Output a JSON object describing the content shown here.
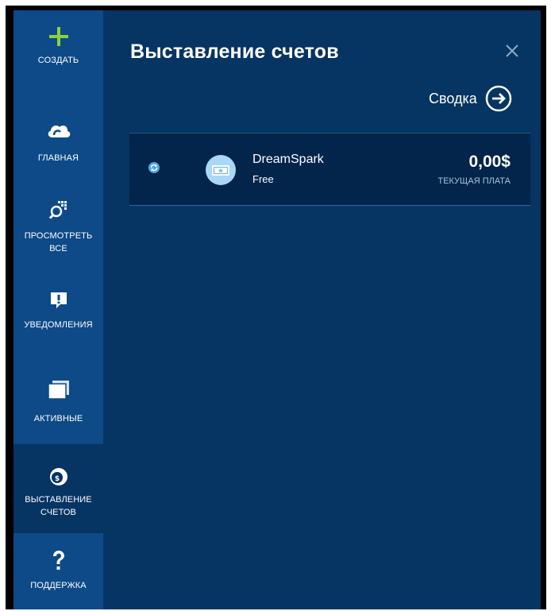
{
  "sidebar": {
    "items": [
      {
        "id": "create",
        "label": "СОЗДАТЬ",
        "icon": "plus-icon",
        "active": false
      },
      {
        "id": "home",
        "label": "ГЛАВНАЯ",
        "icon": "cloud-icon",
        "active": false
      },
      {
        "id": "browse",
        "label": "ПРОСМОТРЕТЬ ВСЕ",
        "icon": "browse-grid-search-icon",
        "active": false
      },
      {
        "id": "notifications",
        "label": "УВЕДОМЛЕНИЯ",
        "icon": "notification-icon",
        "active": false
      },
      {
        "id": "active",
        "label": "АКТИВНЫЕ",
        "icon": "windows-stack-icon",
        "active": false
      },
      {
        "id": "billing",
        "label": "ВЫСТАВЛЕНИЕ СЧЕТОВ",
        "icon": "billing-coin-icon",
        "active": true
      },
      {
        "id": "support",
        "label": "ПОДДЕРЖКА",
        "icon": "question-icon",
        "active": false
      }
    ]
  },
  "panel": {
    "title": "Выставление счетов",
    "close_icon": "close-icon",
    "summary_label": "Сводка",
    "summary_icon": "arrow-right-circle-icon"
  },
  "subscriptions": [
    {
      "name": "DreamSpark",
      "plan": "Free",
      "amount": "0,00$",
      "amount_label": "ТЕКУЩАЯ ПЛАТА",
      "status_icon": "sync-icon",
      "avatar_icon": "ticket-icon"
    }
  ],
  "colors": {
    "sidebar_bg": "#0d4a87",
    "sidebar_active_bg": "#063463",
    "panel_bg": "#063463",
    "row_bg": "#03254b",
    "plus_accent": "#8cd13b",
    "avatar_bg": "#a9d7f5"
  }
}
